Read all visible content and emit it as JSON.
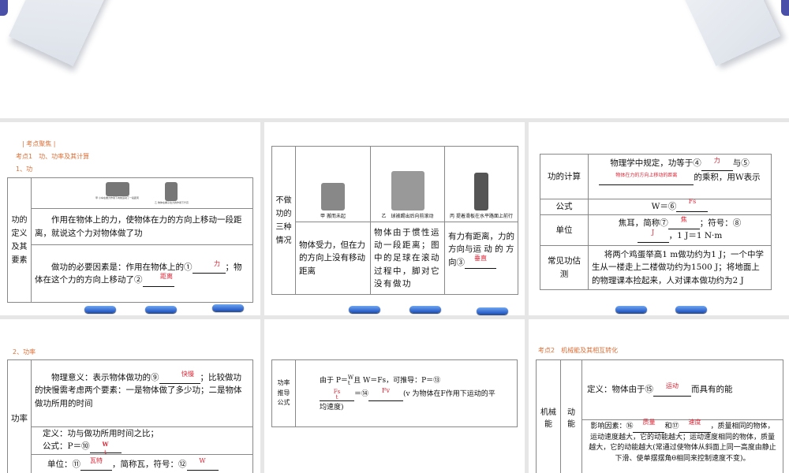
{
  "slide1": {
    "header": "| 考点聚焦 |",
    "topic": "考点1　功、功率及其计算",
    "section": "1、功",
    "row_label": "功的定义及其要素",
    "caption_a": "甲 小车在推力作用下向前运动了一段距离",
    "caption_b": "乙 物体在绳子拉力的作用下升高",
    "definition": "作用在物体上的力，使物体在力的方向上移动一段距离，就说这个力对物体做了功",
    "factors_pre": "做功的必要因素是：作用在物体上的①",
    "ans1": "力",
    "factors_mid": "；物体在这个力的方向上移动了②",
    "ans2": "距离"
  },
  "slide2": {
    "row_label": "不做功的三种情况",
    "cap_a": "甲 搬而未起",
    "cap_b": "乙　球被踢出后向前滚动",
    "cap_c": "丙 提着滑板在水平路面上前行",
    "desc_a": "物体受力，但在力的方向上没有移动距离",
    "desc_b": "物体由于惯性运动一段距离；图中的足球在滚动过程中，脚对它没有做功",
    "desc_c": "有力有距离，力的方向与运 动 的 方 向③",
    "ans3": "垂直"
  },
  "slide3": {
    "rows": [
      {
        "label": "功的计算",
        "pre": "物理学中规定，功等于④",
        "ans4": "力",
        "mid": "与⑤",
        "ans5": "物体在力的方向上移动的距离",
        "post": "的乘积，用W表示"
      },
      {
        "label": "公式",
        "pre": "W＝⑥",
        "ans6": "Fs"
      },
      {
        "label": "单位",
        "pre": "焦耳，简称⑦",
        "ans7": "焦",
        "mid": "；符号：⑧",
        "ans8": "J",
        "post": "，1 J＝1 N·m"
      },
      {
        "label": "常见功估测",
        "text": "将两个鸡蛋举高1 m做功约为1 J；一个中学生从一楼走上二楼做功约为1500 J；将地面上的物理课本捡起来，人对课本做功约为2 J"
      }
    ]
  },
  "slide4": {
    "section": "2、功率",
    "row_label": "功率",
    "meaning_pre": "物理意义：表示物体做功的⑨",
    "ans9": "快慢",
    "meaning_post": "；比较做功的快慢需考虑两个要素：一是物体做了多少功；二是物体做功所用的时间",
    "def": "定义：功与做功所用时间之比；",
    "formula_pre": "公式：P＝⑩",
    "ans10_num": "W",
    "ans10_den": "t",
    "unit_pre": "单位：⑪",
    "ans11": "瓦特",
    "unit_mid": "，简称瓦，符号：⑫",
    "ans12": "W"
  },
  "slide5": {
    "row_label": "功率推导公式",
    "pre": "由于 P＝",
    "frac_num": "W",
    "frac_den": "t",
    "mid": "且 W＝Fs，可推导：P＝⑬",
    "ans13_num": "Fs",
    "ans13_den": "t",
    "eq": "＝⑭",
    "ans14": "Fv",
    "post": "(v 为物体在F作用下运动的平均速度)"
  },
  "slide6": {
    "topic": "考点2　机械能及其相互转化",
    "label1": "机械能",
    "label2": "动能",
    "def_pre": "定义：物体由于⑮",
    "ans15": "运动",
    "def_post": "而具有的能",
    "factor_pre": "影响因素：⑯",
    "ans16": "质量",
    "factor_and": "和⑰",
    "ans17": "速度",
    "factor_post": "，质量相同的物体，运动速度越大，它的动能越大；运动速度相同的物体，质量越大，它的动能越大(常通过使物体从斜面上同一高度由静止下滑、使单摆摆角θ相同来控制速度不变)。"
  }
}
